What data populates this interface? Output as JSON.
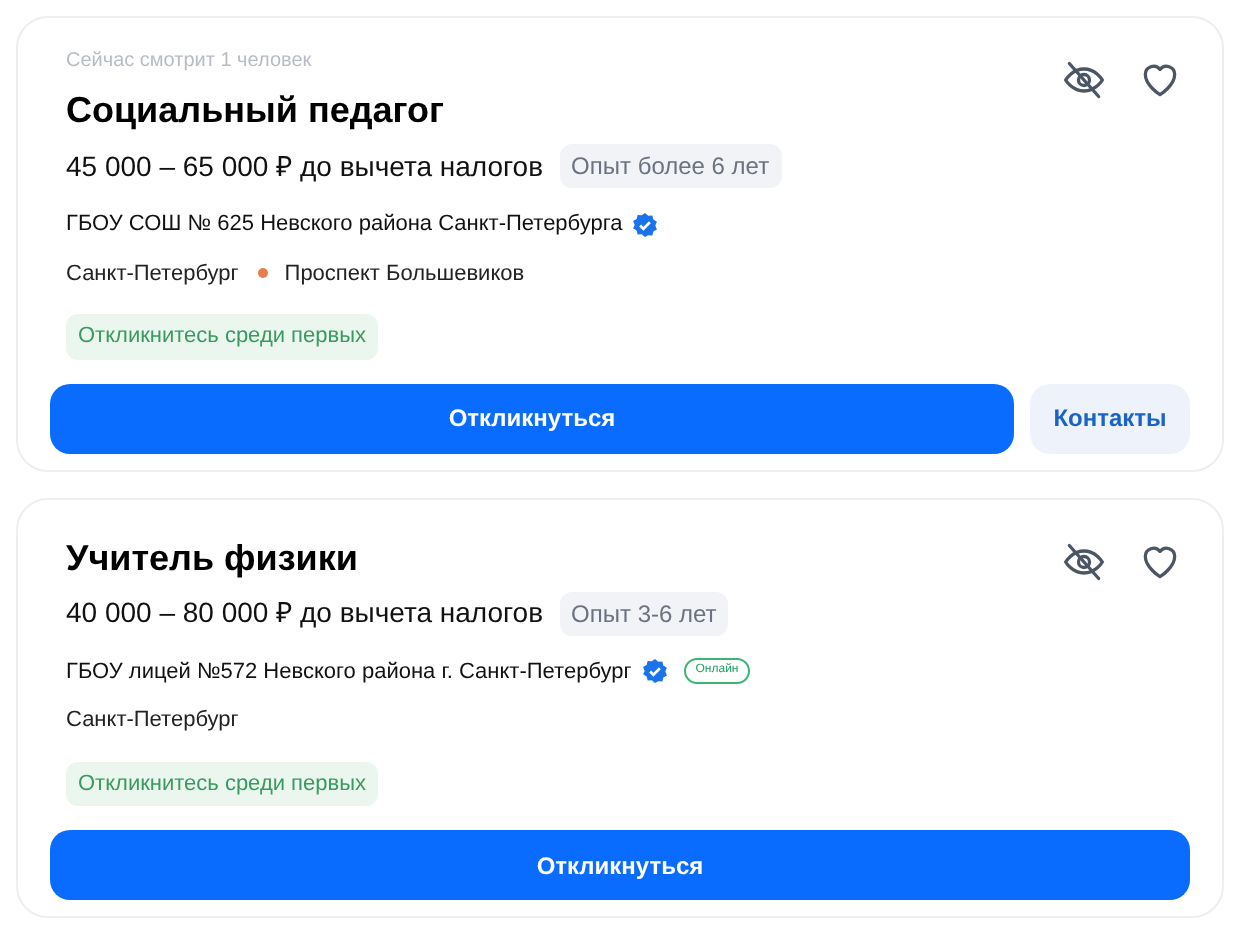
{
  "vacancies": [
    {
      "viewers": "Сейчас смотрит 1 человек",
      "title": "Социальный педагог",
      "salary": "45 000 – 65 000 ₽ до вычета налогов",
      "experience": "Опыт более 6 лет",
      "employer": "ГБОУ СОШ № 625 Невского района Санкт-Петербурга",
      "verified": true,
      "city": "Санкт-Петербург",
      "metro": {
        "name": "Проспект Большевиков",
        "color": "#e5804a"
      },
      "hint": "Откликнитесь среди первых",
      "apply": "Откликнуться",
      "contacts": "Контакты"
    },
    {
      "title": "Учитель физики",
      "salary": "40 000 – 80 000 ₽ до вычета налогов",
      "experience": "Опыт 3-6 лет",
      "employer": "ГБОУ лицей №572 Невского района г. Санкт-Петербург",
      "verified": true,
      "badge": "Онлайн",
      "city": "Санкт-Петербург",
      "hint": "Откликнитесь среди первых",
      "apply": "Откликнуться"
    }
  ]
}
